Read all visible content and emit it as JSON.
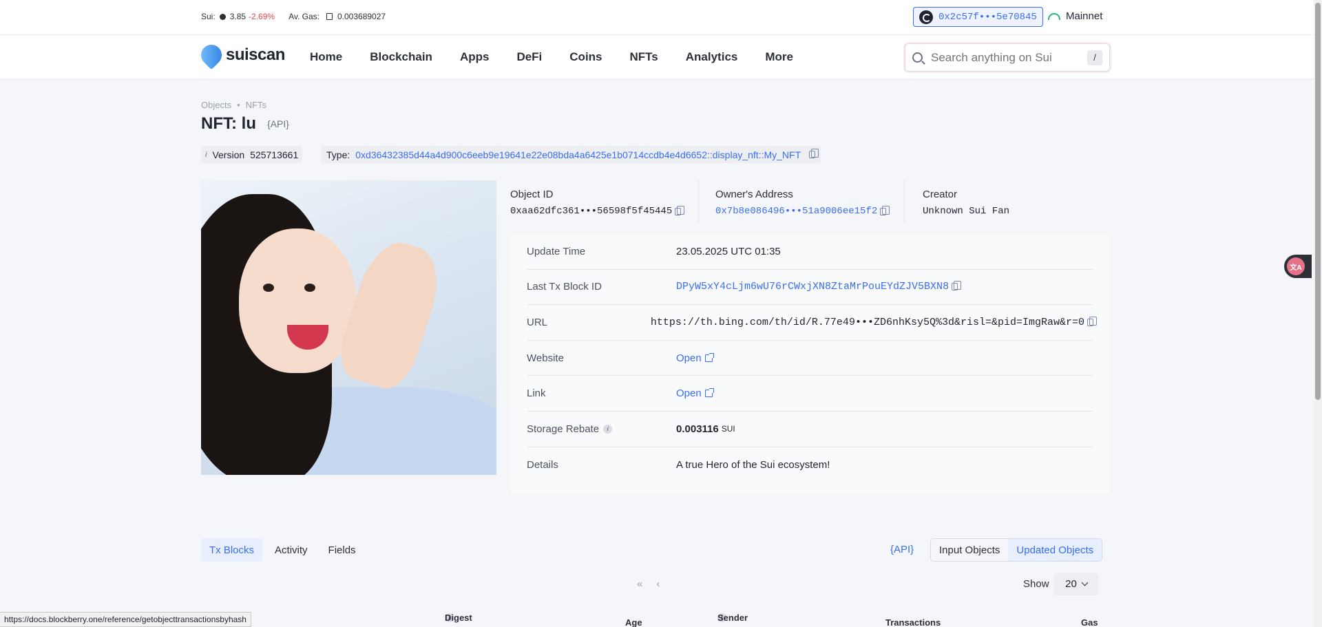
{
  "ticker": {
    "sui_label": "Sui:",
    "sui_price": "3.85",
    "sui_change": "-2.69%",
    "gas_label": "Av. Gas:",
    "gas_value": "0.003689027"
  },
  "wallet": {
    "address": "0x2c57f•••5e70845"
  },
  "network": {
    "label": "Mainnet"
  },
  "nav": {
    "logo": "suiscan",
    "items": [
      "Home",
      "Blockchain",
      "Apps",
      "DeFi",
      "Coins",
      "NFTs",
      "Analytics",
      "More"
    ]
  },
  "search": {
    "placeholder": "Search anything on Sui",
    "shortcut": "/"
  },
  "breadcrumb": {
    "items": [
      "Objects",
      "•",
      "NFTs"
    ]
  },
  "page": {
    "title": "NFT: lu",
    "api_tag": "{API}",
    "version_icon": "i",
    "version_label": "Version",
    "version_value": "525713661",
    "type_label": "Type:",
    "type_value": "0xd36432385d44a4d900c6eeb9e19641e22e08bda4a6425e1b0714ccdb4e4d6652::display_nft::My_NFT"
  },
  "object": {
    "object_id_label": "Object ID",
    "object_id": "0xaa62dfc361•••56598f5f45445",
    "owner_label": "Owner's Address",
    "owner": "0x7b8e086496•••51a9006ee15f2",
    "creator_label": "Creator",
    "creator": "Unknown Sui Fan"
  },
  "details": {
    "rows": [
      {
        "label": "Update Time",
        "value": "23.05.2025 UTC 01:35"
      },
      {
        "label": "Last Tx Block ID",
        "value": "DPyW5xY4cLjm6wU76rCWxjXN8ZtaMrPouEYdZJV5BXN8"
      },
      {
        "label": "URL",
        "value": "https://th.bing.com/th/id/R.77e49•••ZD6nhKsy5Q%3d&risl=&pid=ImgRaw&r=0"
      },
      {
        "label": "Website",
        "value": "Open"
      },
      {
        "label": "Link",
        "value": "Open"
      },
      {
        "label": "Storage Rebate",
        "value": "0.003116",
        "unit": "SUI"
      },
      {
        "label": "Details",
        "value": "A true Hero of the Sui ecosystem!"
      }
    ]
  },
  "tabs": [
    "Tx Blocks",
    "Activity",
    "Fields"
  ],
  "api_link": "{API}",
  "toggle": [
    "Input Objects",
    "Updated Objects"
  ],
  "pager": {
    "first": "«",
    "prev": "‹"
  },
  "show": {
    "label": "Show",
    "value": "20"
  },
  "table": {
    "headers": [
      "Digest",
      "Age",
      "Sender",
      "Transactions",
      "Gas"
    ]
  },
  "statusbar": "https://docs.blockberry.one/reference/getobjecttransactionsbyhash",
  "translate_badge": "文A",
  "colors": {
    "accent": "#3a6df0",
    "negative": "#e5484d",
    "network": "#2bb673"
  }
}
